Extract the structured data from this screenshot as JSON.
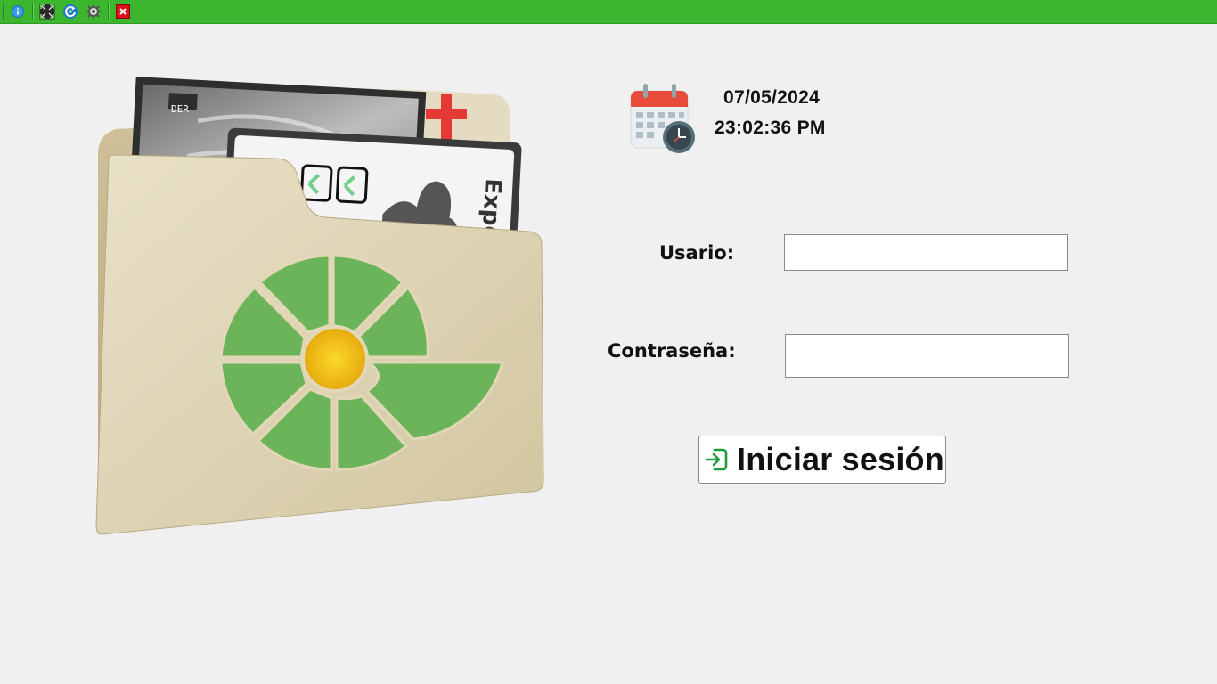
{
  "toolbar": {
    "buttons": [
      {
        "name": "info-icon",
        "color": "#2f8ee0"
      },
      {
        "name": "fullscreen-icon",
        "color": "#222222"
      },
      {
        "name": "refresh-icon",
        "color": "#1a6fd0"
      },
      {
        "name": "gear-icon",
        "color": "#444444"
      },
      {
        "name": "close-icon",
        "color": "#e01010"
      }
    ]
  },
  "illustration": {
    "xray_label": "DER",
    "card_text": "Expe"
  },
  "clock": {
    "date": "07/05/2024",
    "time": "23:02:36 PM"
  },
  "login": {
    "user_label": "Usario:",
    "user_value": "",
    "password_label": "Contraseña:",
    "password_value": "",
    "submit_label": "Iniciar sesión"
  },
  "colors": {
    "titlebar": "#3cb62f",
    "background": "#f0f0f0",
    "logo_green": "#6cb45a",
    "logo_center": "#f2c31b"
  }
}
